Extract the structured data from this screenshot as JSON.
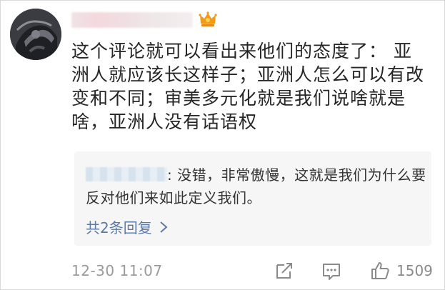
{
  "comment": {
    "text": "这个评论就可以看出来他们的态度了：  亚洲人就应该长这样子；亚洲人怎么可以有改变和不同；审美多元化就是我们说啥就是啥，亚洲人没有话语权"
  },
  "reply": {
    "text": ": 没错，非常傲慢，这就是我们为什么要反对他们来如此定义我们。",
    "more_label": "共2条回复"
  },
  "footer": {
    "timestamp": "12-30 11:07",
    "like_count": "1509"
  },
  "icons": {
    "avatar": "avatar",
    "crown": "crown-icon",
    "chevron": "chevron-right-icon",
    "share": "share-icon",
    "comment": "comment-icon",
    "like": "like-icon"
  },
  "colors": {
    "reply_link": "#5b7aa8",
    "muted": "#9a9a9a",
    "crown": "#f29a1a"
  }
}
